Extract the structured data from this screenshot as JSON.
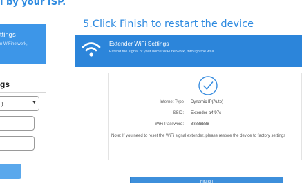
{
  "caption": {
    "top_fragment": "l by your ISP.",
    "step": "5.Click Finish to restart the device"
  },
  "previous_screen": {
    "header_title": "ttings",
    "header_subtitle": "n WiFinetwork,",
    "section_title": "gs",
    "select_value": ")"
  },
  "window": {
    "title": "Extender WiFi Settings",
    "subtitle": "Extend the signal of your home WiFi network, through the wall",
    "rows": [
      {
        "label": "Internet Type",
        "value": "Dynamic IP(Auto)"
      },
      {
        "label": "SSID:",
        "value": "Extender-a4f97c"
      },
      {
        "label": "WiFi Password:",
        "value": "88888888"
      }
    ],
    "note": "Note: If you need to reset the WiFi signal extender, please restore the device to factory settings",
    "finish_label": "FINISH"
  },
  "colors": {
    "accent": "#2c85da",
    "caption": "#2f8be0",
    "button": "#3d8fdb"
  }
}
